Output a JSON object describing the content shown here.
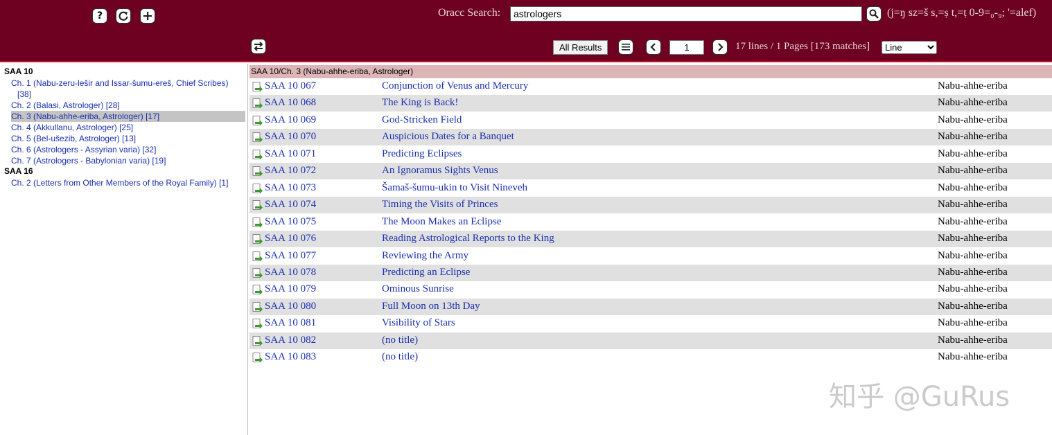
{
  "search": {
    "label": "Oracc Search:",
    "value": "astrologers",
    "help": "(j=ŋ sz=š s,=ṣ t,=ṭ 0-9=₀-₉; '=alef)"
  },
  "toolbar": {
    "all_results_label": "All Results",
    "page_value": "1",
    "status": "17 lines / 1 Pages [173 matches]",
    "view_selected": "Line"
  },
  "sidebar": {
    "groups": [
      {
        "name": "SAA 10",
        "items": [
          {
            "label": "Ch. 1 (Nabu-zeru-lešir and Issar-šumu-ereš, Chief Scribes)",
            "count": "[38]"
          },
          {
            "label": "Ch. 2 (Balasi, Astrologer) [28]"
          },
          {
            "label": "Ch. 3 (Nabu-ahhe-eriba, Astrologer) [17]"
          },
          {
            "label": "Ch. 4 (Akkullanu, Astrologer) [25]"
          },
          {
            "label": "Ch. 5 (Bel-ušezib, Astrologer) [13]"
          },
          {
            "label": "Ch. 6 (Astrologers - Assyrian varia) [32]"
          },
          {
            "label": "Ch. 7 (Astrologers - Babylonian varia) [19]"
          }
        ]
      },
      {
        "name": "SAA 16",
        "items": [
          {
            "label": "Ch. 2 (Letters from Other Members of the Royal Family) [1]"
          }
        ]
      }
    ]
  },
  "content": {
    "header": "SAA 10/Ch. 3 (Nabu-ahhe-eriba, Astrologer)",
    "rows": [
      {
        "id": "SAA 10 067",
        "title": "Conjunction of Venus and Mercury",
        "author": "Nabu-ahhe-eriba"
      },
      {
        "id": "SAA 10 068",
        "title": "The King is Back!",
        "author": "Nabu-ahhe-eriba"
      },
      {
        "id": "SAA 10 069",
        "title": "God-Stricken Field",
        "author": "Nabu-ahhe-eriba"
      },
      {
        "id": "SAA 10 070",
        "title": "Auspicious Dates for a Banquet",
        "author": "Nabu-ahhe-eriba"
      },
      {
        "id": "SAA 10 071",
        "title": "Predicting Eclipses",
        "author": "Nabu-ahhe-eriba"
      },
      {
        "id": "SAA 10 072",
        "title": "An Ignoramus Sights Venus",
        "author": "Nabu-ahhe-eriba"
      },
      {
        "id": "SAA 10 073",
        "title": "Šamaš-šumu-ukin to Visit Nineveh",
        "author": "Nabu-ahhe-eriba"
      },
      {
        "id": "SAA 10 074",
        "title": "Timing the Visits of Princes",
        "author": "Nabu-ahhe-eriba"
      },
      {
        "id": "SAA 10 075",
        "title": "The Moon Makes an Eclipse",
        "author": "Nabu-ahhe-eriba"
      },
      {
        "id": "SAA 10 076",
        "title": "Reading Astrological Reports to the King",
        "author": "Nabu-ahhe-eriba"
      },
      {
        "id": "SAA 10 077",
        "title": "Reviewing the Army",
        "author": "Nabu-ahhe-eriba"
      },
      {
        "id": "SAA 10 078",
        "title": "Predicting an Eclipse",
        "author": "Nabu-ahhe-eriba"
      },
      {
        "id": "SAA 10 079",
        "title": "Ominous Sunrise",
        "author": "Nabu-ahhe-eriba"
      },
      {
        "id": "SAA 10 080",
        "title": "Full Moon on 13th Day",
        "author": "Nabu-ahhe-eriba"
      },
      {
        "id": "SAA 10 081",
        "title": "Visibility of Stars",
        "author": "Nabu-ahhe-eriba"
      },
      {
        "id": "SAA 10 082",
        "title": "(no title)",
        "author": "Nabu-ahhe-eriba"
      },
      {
        "id": "SAA 10 083",
        "title": "(no title)",
        "author": "Nabu-ahhe-eriba"
      }
    ]
  },
  "watermark": "知乎 @GuRus",
  "colors": {
    "header_bg": "#6e0022",
    "link": "#1a2fb0",
    "row_alt": "#e0e0e0",
    "content_header_bg": "#dcb6b6"
  },
  "icons": [
    "help-icon",
    "refresh-icon",
    "add-icon",
    "swap-icon",
    "search-icon",
    "menu-icon",
    "chevron-left-icon",
    "chevron-right-icon",
    "document-arrow-icon"
  ]
}
